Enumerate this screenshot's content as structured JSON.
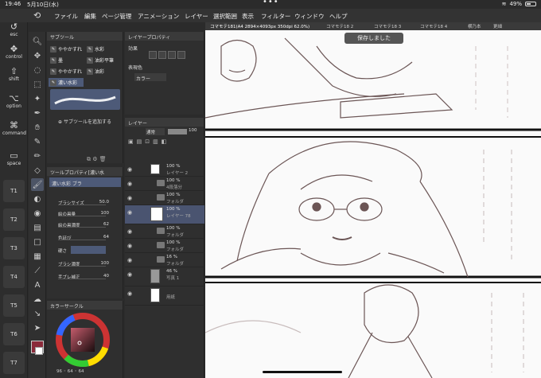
{
  "status": {
    "time": "19:46",
    "date": "5月10日(水)",
    "battery": "49%",
    "battery_level": 0.49
  },
  "menu": [
    "ファイル",
    "編集",
    "ページ管理",
    "アニメーション",
    "レイヤー",
    "選択範囲",
    "表示",
    "フィルター",
    "ウィンドウ",
    "ヘルプ"
  ],
  "keys": {
    "esc": "esc",
    "control": "control",
    "shift": "shift",
    "option": "option",
    "command": "command",
    "space": "space",
    "t_keys": [
      "T1",
      "T2",
      "T3",
      "T4",
      "T5",
      "T6",
      "T7"
    ]
  },
  "subtool": {
    "title": "サブツール",
    "items": [
      {
        "label": "ややかすれ",
        "col": 0
      },
      {
        "label": "水彩",
        "col": 1
      },
      {
        "label": "墨",
        "col": 0
      },
      {
        "label": "油彩平筆",
        "col": 1
      },
      {
        "label": "ややかすれ",
        "col": 0
      },
      {
        "label": "油彩",
        "col": 1
      },
      {
        "label": "濃い水彩",
        "col": 0,
        "selected": true
      }
    ],
    "add_label": "サブツールを追加する"
  },
  "toolprop": {
    "title": "ツールプロパティ[濃い水",
    "brush_name": "濃い水彩 ブラ",
    "rows": [
      {
        "label": "ブラシサイズ",
        "value": "50.0"
      },
      {
        "label": "絵の具量",
        "value": "100"
      },
      {
        "label": "絵の具濃度",
        "value": "62"
      },
      {
        "label": "色延び",
        "value": "64"
      },
      {
        "label": "硬さ",
        "value": ""
      },
      {
        "label": "ブラシ濃度",
        "value": "100"
      },
      {
        "label": "手ブレ補正",
        "value": "40"
      }
    ]
  },
  "colorpanel": {
    "title": "カラーサークル",
    "h": "96",
    "s": "64",
    "v": "64",
    "main_color": "#8a2a3a"
  },
  "layerprop": {
    "title": "レイヤープロパティ",
    "effect_label": "効果",
    "expression_label": "表現色",
    "expression_value": "カラー"
  },
  "layers": {
    "title": "レイヤー",
    "blend": "通常",
    "opacity": "100",
    "rows": [
      {
        "pct": "100 %",
        "name": "レイヤー 2",
        "type": "raster"
      },
      {
        "pct": "100 %",
        "name": "4段落分",
        "type": "folder"
      },
      {
        "pct": "100 %",
        "name": "フォルダ",
        "type": "folder"
      },
      {
        "pct": "100 %",
        "name": "レイヤー 78",
        "type": "raster",
        "selected": true
      },
      {
        "pct": "100 %",
        "name": "フォルダ",
        "type": "folder"
      },
      {
        "pct": "100 %",
        "name": "フォルダ",
        "type": "folder"
      },
      {
        "pct": "16 %",
        "name": "フォルダ",
        "type": "folder"
      },
      {
        "pct": "46 %",
        "name": "写真 1",
        "type": "raster"
      },
      {
        "pct": "",
        "name": "用紙",
        "type": "paper"
      }
    ]
  },
  "tabs": [
    "コマモテ181(A4 2894×4093px 350dpi 62.0%)",
    "コマモテ18 2",
    "コマモテ18 3",
    "コマモテ18 4",
    "横乃本",
    "更細"
  ],
  "toast": "保存しました"
}
